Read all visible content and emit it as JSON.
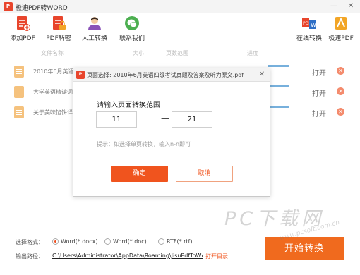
{
  "window": {
    "title": "极速PDF转WORD",
    "min_glyph": "—",
    "close_glyph": "✕"
  },
  "toolbar": {
    "add_pdf": "添加PDF",
    "pdf_decrypt": "PDF解密",
    "manual_convert": "人工转换",
    "contact_us": "联系我们",
    "online_convert": "在线转换",
    "speed_pdf": "极速PDF"
  },
  "columns": {
    "file_name": "文件名称",
    "size": "大小",
    "page_range": "页数范围",
    "progress": "进度"
  },
  "files": [
    {
      "name": "2010年6月英语四",
      "open": "打开",
      "progress": 0.25
    },
    {
      "name": "大学英语精读词",
      "open": "打开",
      "progress": 0.25
    },
    {
      "name": "关于美味馅饼详细",
      "open": "打开",
      "progress": 0.25
    }
  ],
  "dialog": {
    "title": "页面选择: 2010年6月英语四级考试真题及答案及听力原文.pdf",
    "prompt": "请输入页面转换范围",
    "from_page": "11",
    "to_page": "21",
    "separator": "—",
    "hint": "提示：如选择单页转换，输入n-n即可",
    "ok": "确定",
    "cancel": "取消"
  },
  "bottom": {
    "format_label": "选择格式：",
    "formats": [
      "Word(*.docx)",
      "Word(*.doc)",
      "RTF(*.rtf)"
    ],
    "selected_format": "Word(*.docx)",
    "output_label": "输出路径：",
    "output_path": "C:\\Users\\Administrator\\AppData\\Roaming\\JisuPdfToWc",
    "open_dir": "打开目录",
    "start": "开始转换"
  },
  "watermark": {
    "main": "PC下载网",
    "sub": "www.pcsoft.com.cn"
  },
  "colors": {
    "accent": "#f0541e",
    "progress": "#2f86c9",
    "file_icon": "#f0a23a"
  }
}
